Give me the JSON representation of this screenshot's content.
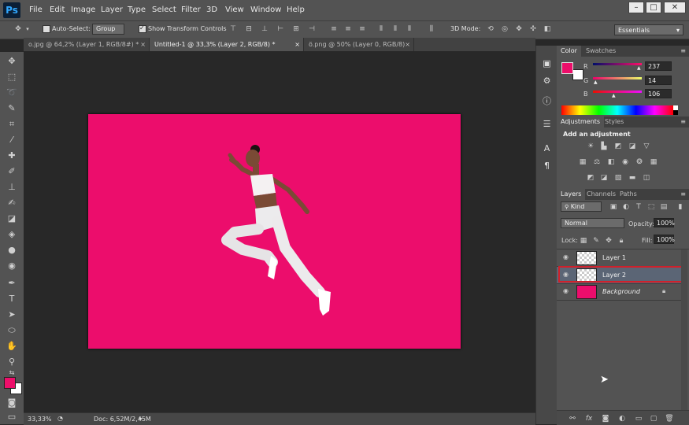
{
  "app": {
    "logo": "Ps"
  },
  "menu": [
    "File",
    "Edit",
    "Image",
    "Layer",
    "Type",
    "Select",
    "Filter",
    "3D",
    "View",
    "Window",
    "Help"
  ],
  "window_controls": {
    "minimize": "–",
    "maximize": "□",
    "close": "✕"
  },
  "options_bar": {
    "auto_select_label": "Auto-Select:",
    "auto_select_value": "Group",
    "show_transform_label": "Show Transform Controls",
    "mode_3d_label": "3D Mode:",
    "workspace": "Essentials"
  },
  "tabs": [
    {
      "label": "o.jpg @ 64,2% (Layer 1, RGB/8#) *",
      "active": false
    },
    {
      "label": "Untitled-1 @ 33,3% (Layer 2, RGB/8) *",
      "active": true
    },
    {
      "label": "ö.png @ 50% (Layer 0, RGB/8)",
      "active": false
    }
  ],
  "status_bar": {
    "zoom": "33,33%",
    "doc": "Doc: 6,52M/2,45M"
  },
  "color_panel": {
    "tabs": [
      "Color",
      "Swatches"
    ],
    "r_label": "R",
    "r_value": "237",
    "g_label": "G",
    "g_value": "14",
    "b_label": "B",
    "b_value": "106",
    "foreground": "#ed0e6a",
    "background": "#ffffff"
  },
  "adjustments_panel": {
    "tabs": [
      "Adjustments",
      "Styles"
    ],
    "heading": "Add an adjustment"
  },
  "layers_panel": {
    "tabs": [
      "Layers",
      "Channels",
      "Paths"
    ],
    "filter_label": "Kind",
    "blend_mode": "Normal",
    "opacity_label": "Opacity:",
    "opacity_value": "100%",
    "lock_label": "Lock:",
    "fill_label": "Fill:",
    "fill_value": "100%",
    "layers": [
      {
        "name": "Layer 1",
        "selected": false,
        "type": "transparent"
      },
      {
        "name": "Layer 2",
        "selected": true,
        "type": "transparent"
      },
      {
        "name": "Background",
        "selected": false,
        "type": "fill",
        "color": "#ec0d6c",
        "locked": true
      }
    ]
  },
  "canvas": {
    "fill_color": "#ec0d6c"
  },
  "highlight_color": "#d0202a"
}
